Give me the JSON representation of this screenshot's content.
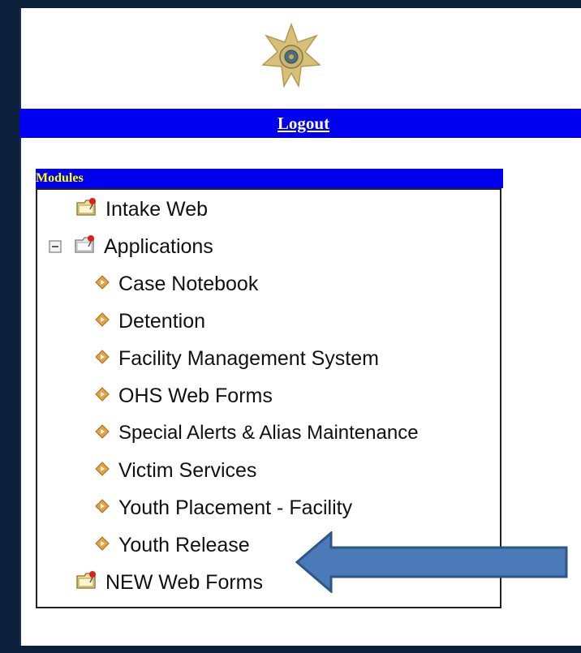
{
  "header": {
    "logout_label": "Logout"
  },
  "modules": {
    "header_label": "Modules",
    "tree": {
      "intake_web": "Intake Web",
      "applications": {
        "label": "Applications",
        "expanded": true,
        "children": [
          "Case Notebook",
          "Detention",
          "Facility Management System",
          "OHS Web Forms",
          "Special Alerts & Alias Maintenance",
          "Victim Services",
          "Youth Placement - Facility",
          "Youth Release"
        ]
      },
      "new_web_forms": "NEW Web Forms"
    }
  },
  "annotation": {
    "arrow_color": "#4a7ab8",
    "points_to": "Youth Release"
  },
  "colors": {
    "bar": "#0000ee",
    "modules_text": "#ffff00",
    "frame": "#0b1e3a"
  }
}
